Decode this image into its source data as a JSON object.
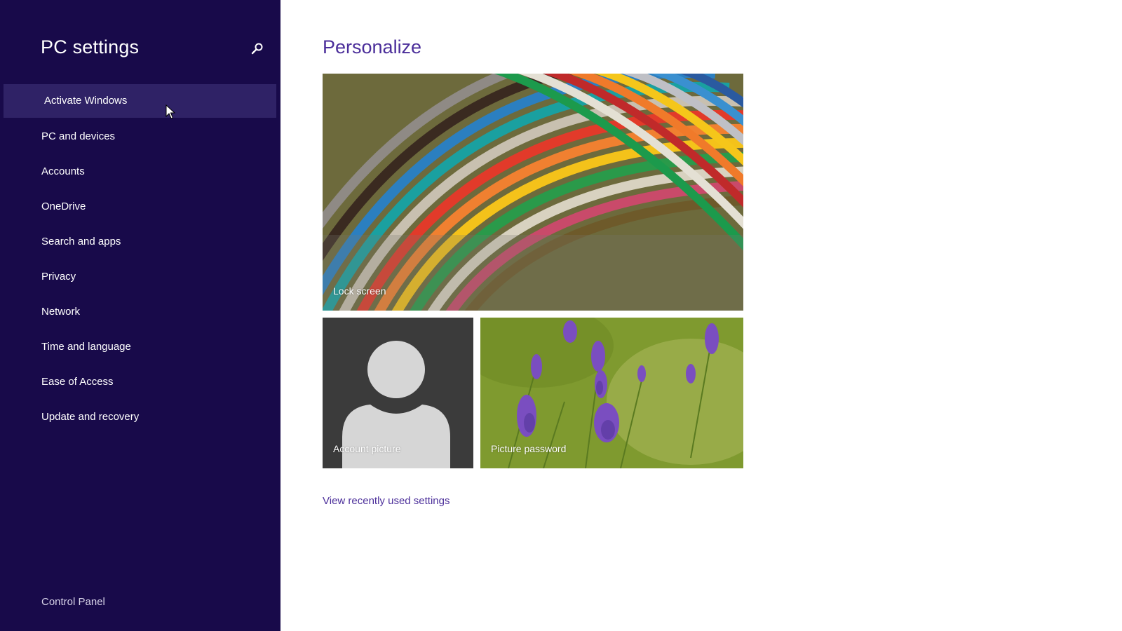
{
  "sidebar": {
    "title": "PC settings",
    "search_icon": "search-icon",
    "items": [
      {
        "label": "Activate Windows",
        "active": true
      },
      {
        "label": "PC and devices"
      },
      {
        "label": "Accounts"
      },
      {
        "label": "OneDrive"
      },
      {
        "label": "Search and apps"
      },
      {
        "label": "Privacy"
      },
      {
        "label": "Network"
      },
      {
        "label": "Time and language"
      },
      {
        "label": "Ease of Access"
      },
      {
        "label": "Update and recovery"
      }
    ],
    "footer_link": "Control Panel"
  },
  "main": {
    "title": "Personalize",
    "tiles": {
      "lock_screen": "Lock screen",
      "account_picture": "Account picture",
      "picture_password": "Picture password"
    },
    "recent_link": "View recently used settings"
  },
  "colors": {
    "sidebar_bg": "#180a4a",
    "sidebar_active_bg": "#2f2266",
    "accent": "#4b2e9a"
  }
}
